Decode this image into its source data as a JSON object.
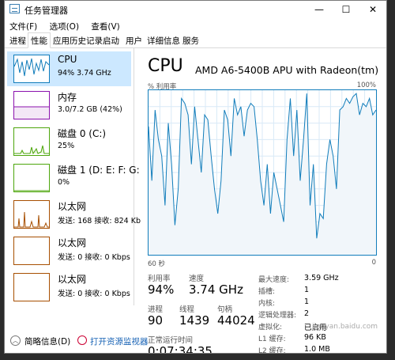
{
  "window": {
    "title": "任务管理器",
    "minimize": "—",
    "maximize": "☐",
    "close": "✕"
  },
  "menu": [
    "文件(F)",
    "选项(O)",
    "查看(V)"
  ],
  "tabs": [
    "进程",
    "性能",
    "应用历史记录",
    "启动",
    "用户",
    "详细信息",
    "服务"
  ],
  "active_tab": "性能",
  "sidebar": [
    {
      "name": "CPU",
      "sub": "94% 3.74 GHz",
      "color": "#117dbb",
      "selected": true
    },
    {
      "name": "内存",
      "sub": "3.0/7.2 GB (42%)",
      "color": "#8b12ae"
    },
    {
      "name": "磁盘 0 (C:)",
      "sub": "25%",
      "color": "#4da60c"
    },
    {
      "name": "磁盘 1 (D: E: F: G:",
      "sub": "0%",
      "color": "#4da60c"
    },
    {
      "name": "以太网",
      "sub": "发送: 168 接收: 824 Kb",
      "color": "#a74f01"
    },
    {
      "name": "以太网",
      "sub": "发送: 0 接收: 0 Kbps",
      "color": "#a74f01"
    },
    {
      "name": "以太网",
      "sub": "发送: 0 接收: 0 Kbps",
      "color": "#a74f01"
    }
  ],
  "cpu": {
    "title": "CPU",
    "model": "AMD A6-5400B APU with Radeon(tm)",
    "graph_label": "% 利用率",
    "graph_max": "100%",
    "graph_time": "60 秒",
    "graph_min": "0",
    "utilization_label": "利用率",
    "utilization": "94%",
    "speed_label": "速度",
    "speed": "3.74 GHz",
    "processes_label": "进程",
    "processes": "90",
    "threads_label": "线程",
    "threads": "1439",
    "handles_label": "句柄",
    "handles": "44024",
    "uptime_label": "正常运行时间",
    "uptime": "0:07:34:35",
    "details": [
      {
        "label": "最大速度:",
        "value": "3.59 GHz"
      },
      {
        "label": "插槽:",
        "value": "1"
      },
      {
        "label": "内核:",
        "value": "1"
      },
      {
        "label": "逻辑处理器:",
        "value": "2"
      },
      {
        "label": "虚拟化:",
        "value": "已启用"
      },
      {
        "label": "L1 缓存:",
        "value": "96 KB"
      },
      {
        "label": "L2 缓存:",
        "value": "1.0 MB"
      }
    ],
    "history": [
      78,
      45,
      88,
      70,
      60,
      30,
      80,
      55,
      18,
      40,
      95,
      92,
      85,
      55,
      90,
      70,
      50,
      85,
      82,
      60,
      40,
      25,
      45,
      88,
      82,
      60,
      95,
      85,
      90,
      72,
      88,
      92,
      90,
      70,
      45,
      30,
      55,
      25,
      50,
      40,
      30,
      20,
      70,
      95,
      60,
      88,
      45,
      70,
      98,
      30,
      55,
      10,
      25,
      22,
      55,
      70,
      60,
      40,
      88,
      90,
      95,
      92,
      96,
      98,
      85,
      92,
      90,
      95,
      85,
      88
    ]
  },
  "footer": {
    "collapse": "简略信息(D)",
    "monitor": "打开资源监视器"
  },
  "watermark": "jingyan.baidu.com"
}
